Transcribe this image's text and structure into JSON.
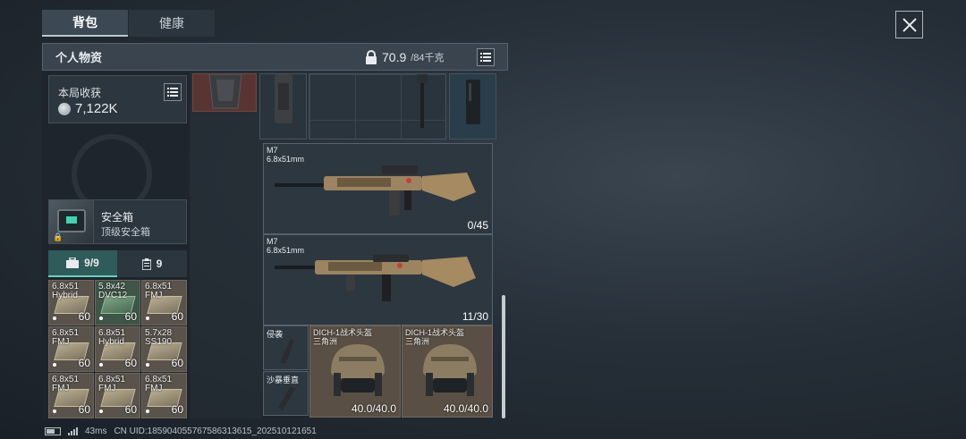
{
  "tabs": [
    {
      "label": "背包"
    },
    {
      "label": "健康"
    }
  ],
  "header": {
    "title": "个人物资",
    "weight_current": "70.9",
    "weight_max": "/84千克"
  },
  "loot": {
    "label": "本局收获",
    "value": "7,122K"
  },
  "safe_box": {
    "title": "安全箱",
    "subtitle": "顶级安全箱"
  },
  "subtabs": [
    {
      "label": "9/9",
      "icon": "briefcase-icon"
    },
    {
      "label": "9",
      "icon": "clipboard-icon"
    }
  ],
  "ammo": [
    {
      "name": "6.8x51\nHybrid",
      "count": "60",
      "variant": "tan"
    },
    {
      "name": "5.8x42\nDVC12",
      "count": "60",
      "variant": "green"
    },
    {
      "name": "6.8x51\nFMJ",
      "count": "60",
      "variant": "tan"
    },
    {
      "name": "6.8x51\nFMJ",
      "count": "60",
      "variant": "tan"
    },
    {
      "name": "6.8x51\nHybrid",
      "count": "60",
      "variant": "tan"
    },
    {
      "name": "5.7x28\nSS190",
      "count": "60",
      "variant": "tan"
    },
    {
      "name": "6.8x51\nFMJ",
      "count": "60",
      "variant": "tan"
    },
    {
      "name": "6.8x51\nFMJ",
      "count": "60",
      "variant": "tan"
    },
    {
      "name": "6.8x51\nFMJ",
      "count": "60",
      "variant": "tan"
    }
  ],
  "weapons": [
    {
      "name": "M7",
      "caliber": "6.8x51mm",
      "ammo": "0/45"
    },
    {
      "name": "M7",
      "caliber": "6.8x51mm",
      "ammo": "11/30"
    }
  ],
  "attachments": [
    {
      "name": "侵袭"
    },
    {
      "name": "沙暴垂直"
    }
  ],
  "helmets": [
    {
      "name": "DICH-1战术头盔",
      "sub": "三角洲",
      "durability": "40.0/40.0"
    },
    {
      "name": "DICH-1战术头盔",
      "sub": "三角洲",
      "durability": "40.0/40.0"
    }
  ],
  "status": {
    "ping": "43ms",
    "uid": "CN UID:185904055767586313615_202510121651"
  },
  "colors": {
    "accent_teal": "#6ad0c0",
    "helmet_bg": "#5a4f44",
    "red_slot": "#5a3432"
  }
}
